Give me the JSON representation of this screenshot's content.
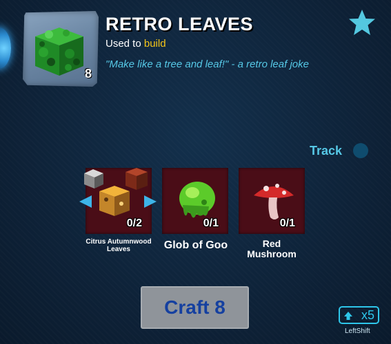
{
  "item": {
    "name": "RETRO LEAVES",
    "used_to_prefix": "Used to",
    "used_to_action": "build",
    "quote": "\"Make like a tree and leaf!\" - a retro leaf joke",
    "count": "8",
    "icon": "green-leaf-block-icon"
  },
  "track": {
    "label": "Track"
  },
  "ingredients": [
    {
      "name": "Citrus Autumnwood Leaves",
      "count": "0/2",
      "icon": "autumn-leaf-blocks-icon"
    },
    {
      "name": "Glob of Goo",
      "count": "0/1",
      "icon": "green-goo-icon"
    },
    {
      "name": "Red Mushroom",
      "count": "0/1",
      "icon": "red-mushroom-icon"
    }
  ],
  "craft": {
    "label": "Craft 8"
  },
  "multiplier": {
    "label": "x5",
    "key": "LeftShift"
  },
  "colors": {
    "accent": "#56c8e6",
    "highlight": "#f5c518",
    "slot_bg": "#4a0d17",
    "craft_text": "#1540a0"
  }
}
